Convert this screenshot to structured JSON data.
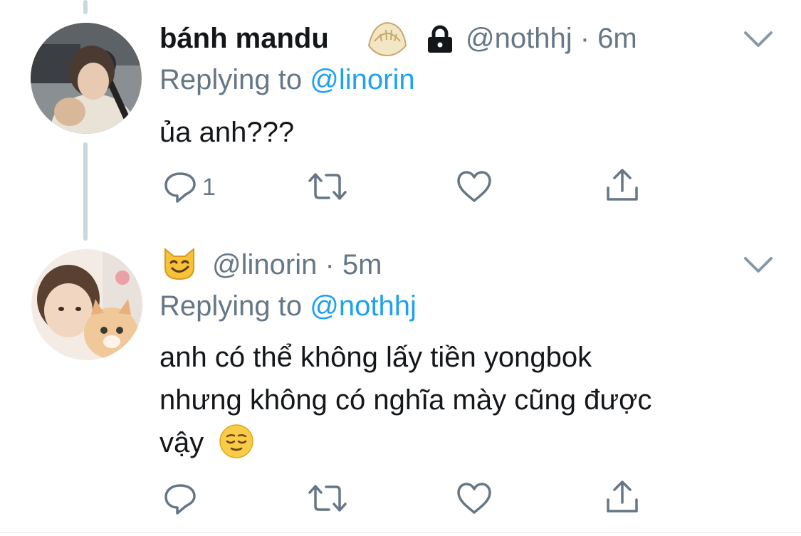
{
  "tweets": [
    {
      "display_name": "bánh mandu",
      "name_emoji": "dumpling-emoji",
      "locked": true,
      "handle": "@nothhj",
      "time": "6m",
      "replying_prefix": "Replying to",
      "replying_to": "@linorin",
      "text_lines": [
        "ủa anh???"
      ],
      "reply_count": "1",
      "retweet_count": "",
      "like_count": ""
    },
    {
      "display_name": "",
      "name_emoji": "grinning-cat-emoji",
      "locked": false,
      "handle": "@linorin",
      "time": "5m",
      "replying_prefix": "Replying to",
      "replying_to": "@nothhj",
      "text_lines": [
        "anh có thể không lấy tiền yongbok",
        "nhưng không có nghĩa mày cũng được",
        "vậy"
      ],
      "text_emoji": "relieved-face-emoji",
      "reply_count": "",
      "retweet_count": "",
      "like_count": ""
    }
  ],
  "colors": {
    "primary_text": "#14171a",
    "secondary_text": "#657786",
    "link": "#1da1f2",
    "thread_line": "#ccd6dd",
    "icon": "#657786"
  },
  "icons": [
    "reply-icon",
    "retweet-icon",
    "like-icon",
    "share-icon",
    "lock-icon",
    "chevron-down-icon"
  ]
}
